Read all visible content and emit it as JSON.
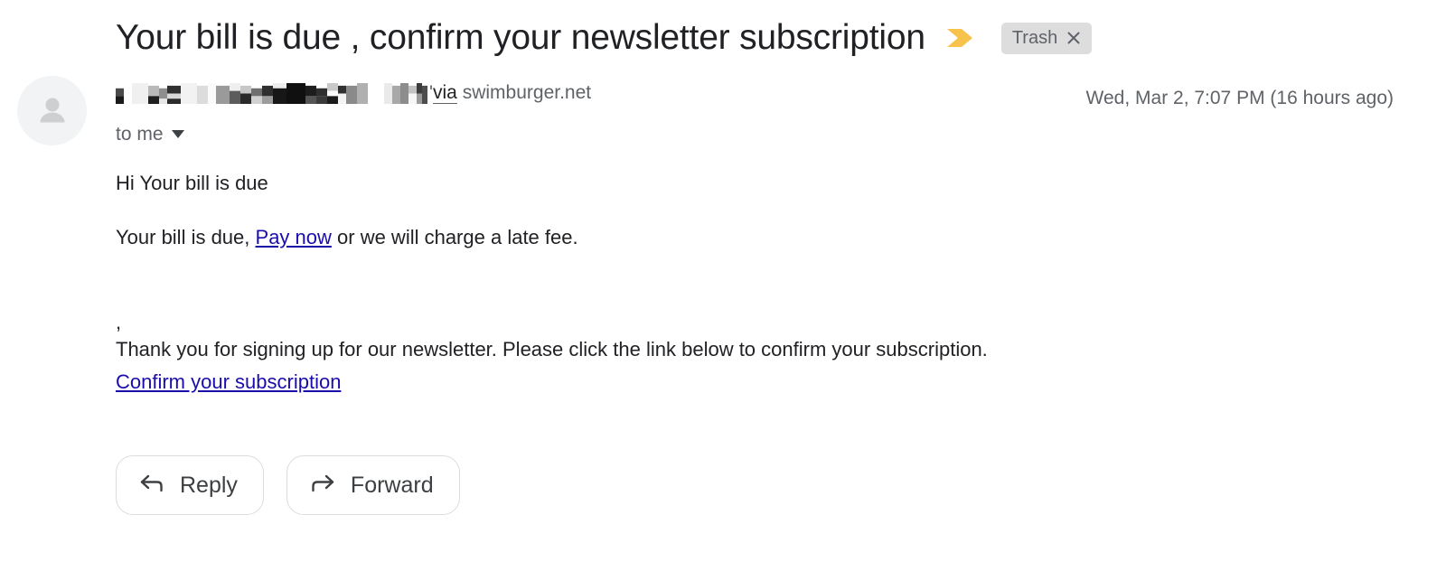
{
  "subject": {
    "text": "Your bill is due , confirm your newsletter subscription",
    "important_marker_icon": "important-arrow-icon",
    "important_marker_color": "#f7c34a"
  },
  "label_chip": {
    "name": "Trash",
    "close_icon": "close-icon",
    "background": "#ddddde",
    "text_color": "#5f6368"
  },
  "message": {
    "avatar_icon": "person-avatar-icon",
    "sender_name_redacted": "██████████████",
    "sender_suffix": "'",
    "via_label": "via",
    "via_domain": "swimburger.net",
    "timestamp": "Wed, Mar 2, 7:07 PM (16 hours ago)",
    "recipient": "to me",
    "recipient_caret_icon": "caret-down-icon"
  },
  "body": {
    "greeting": "Hi Your bill is due",
    "bill_text_before": "Your bill is due, ",
    "bill_link": "Pay now",
    "bill_text_after": " or we will charge a late fee.",
    "comma_line": ",",
    "newsletter_text": "Thank you for signing up for our newsletter. Please click the link below to confirm your subscription.",
    "confirm_link": "Confirm your subscription",
    "link_color": "#1a0dab"
  },
  "actions": {
    "reply_label": "Reply",
    "reply_icon": "reply-arrow-icon",
    "forward_label": "Forward",
    "forward_icon": "forward-arrow-icon"
  }
}
